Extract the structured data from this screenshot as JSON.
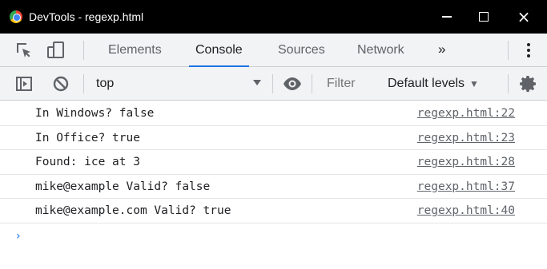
{
  "window": {
    "title": "DevTools - regexp.html",
    "controls": {
      "minimize": "minimize-icon",
      "maximize": "maximize-icon",
      "close": "×"
    }
  },
  "tabs": {
    "items": [
      {
        "label": "Elements",
        "active": false
      },
      {
        "label": "Console",
        "active": true
      },
      {
        "label": "Sources",
        "active": false
      },
      {
        "label": "Network",
        "active": false
      }
    ],
    "overflow": "»",
    "accent_color": "#1a73e8"
  },
  "toolbar": {
    "context": "top",
    "filter_placeholder": "Filter",
    "levels_label": "Default levels",
    "levels_caret": "▼"
  },
  "console": {
    "messages": [
      {
        "text": "In Windows? false",
        "source": "regexp.html:22"
      },
      {
        "text": "In Office? true",
        "source": "regexp.html:23"
      },
      {
        "text": "Found: ice at 3",
        "source": "regexp.html:28"
      },
      {
        "text": "mike@example Valid? false",
        "source": "regexp.html:37"
      },
      {
        "text": "mike@example.com Valid? true",
        "source": "regexp.html:40"
      }
    ],
    "prompt": "›"
  }
}
